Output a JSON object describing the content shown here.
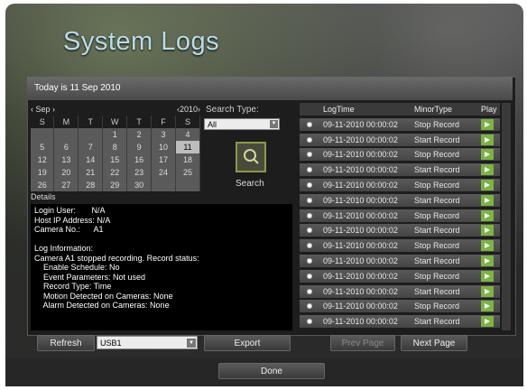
{
  "header": {
    "title": "System Logs",
    "today": "Today is 11 Sep 2010"
  },
  "calendar": {
    "month": "Sep",
    "year": "2010",
    "weekdays": [
      "S",
      "M",
      "T",
      "W",
      "T",
      "F",
      "S"
    ],
    "weeks": [
      [
        "",
        "",
        "",
        "1",
        "2",
        "3",
        "4"
      ],
      [
        "5",
        "6",
        "7",
        "8",
        "9",
        "10",
        "11"
      ],
      [
        "12",
        "13",
        "14",
        "15",
        "16",
        "17",
        "18"
      ],
      [
        "19",
        "20",
        "21",
        "22",
        "23",
        "24",
        "25"
      ],
      [
        "26",
        "27",
        "28",
        "29",
        "30",
        "",
        ""
      ]
    ],
    "selected_day": "11"
  },
  "search": {
    "type_label": "Search Type:",
    "type_value": "All",
    "button_label": "Search"
  },
  "details": {
    "label": "Details",
    "lines": [
      "Login User:       N/A",
      "Host IP Address: N/A",
      "Camera No.:      A1",
      "",
      "Log Information:",
      "Camera A1 stopped recording. Record status:",
      "    Enable Schedule: No",
      "    Event Parameters: Not used",
      "    Record Type: Time",
      "    Motion Detected on Cameras: None",
      "    Alarm Detected on Cameras: None"
    ]
  },
  "table": {
    "columns": [
      "",
      "LogTime",
      "MinorType",
      "Play"
    ],
    "rows": [
      {
        "time": "09-11-2010 00:00:02",
        "type": "Stop Record"
      },
      {
        "time": "09-11-2010 00:00:02",
        "type": "Start Record"
      },
      {
        "time": "09-11-2010 00:00:02",
        "type": "Stop Record"
      },
      {
        "time": "09-11-2010 00:00:02",
        "type": "Start Record"
      },
      {
        "time": "09-11-2010 00:00:02",
        "type": "Stop Record"
      },
      {
        "time": "09-11-2010 00:00:02",
        "type": "Start Record"
      },
      {
        "time": "09-11-2010 00:00:02",
        "type": "Stop Record"
      },
      {
        "time": "09-11-2010 00:00:02",
        "type": "Start Record"
      },
      {
        "time": "09-11-2010 00:00:02",
        "type": "Stop Record"
      },
      {
        "time": "09-11-2010 00:00:02",
        "type": "Start Record"
      },
      {
        "time": "09-11-2010 00:00:02",
        "type": "Stop Record"
      },
      {
        "time": "09-11-2010 00:00:02",
        "type": "Start Record"
      },
      {
        "time": "09-11-2010 00:00:02",
        "type": "Stop Record"
      },
      {
        "time": "09-11-2010 00:00:02",
        "type": "Start Record"
      }
    ]
  },
  "footer": {
    "refresh": "Refresh",
    "usb": "USB1",
    "export": "Export",
    "prev": "Prev Page",
    "next": "Next Page",
    "done": "Done"
  },
  "colors": {
    "play_green": "#7cb342",
    "title_blue": "#b9dde9"
  }
}
